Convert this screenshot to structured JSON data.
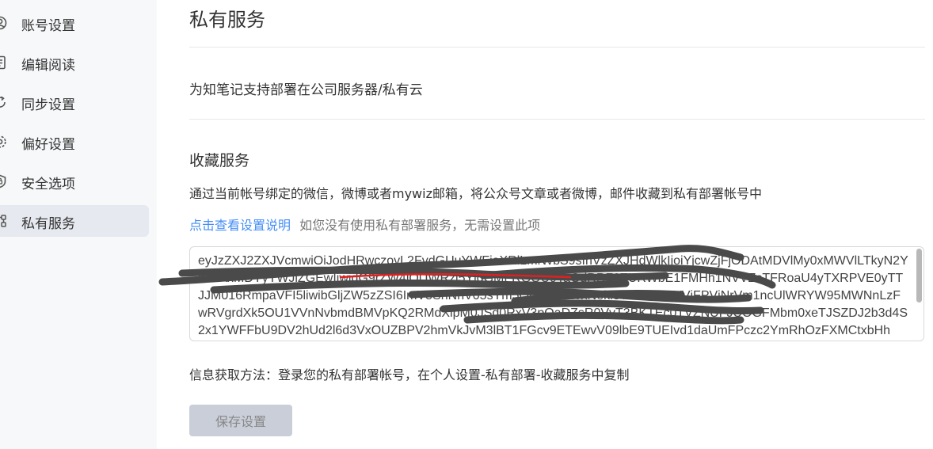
{
  "sidebar": {
    "items": [
      {
        "label": "账号设置",
        "icon": "user-circle-icon"
      },
      {
        "label": "编辑阅读",
        "icon": "document-icon"
      },
      {
        "label": "同步设置",
        "icon": "sync-icon"
      },
      {
        "label": "偏好设置",
        "icon": "gear-icon"
      },
      {
        "label": "安全选项",
        "icon": "shield-icon"
      },
      {
        "label": "私有服务",
        "icon": "network-icon",
        "active": true
      }
    ]
  },
  "main": {
    "title": "私有服务",
    "description": "为知笔记支持部署在公司服务器/私有云",
    "collect": {
      "title": "收藏服务",
      "description": "通过当前帐号绑定的微信，微博或者mywiz邮箱，将公众号文章或者微博，邮件收藏到私有部署帐号中",
      "help_link": "点击查看设置说明",
      "help_note": "如您没有使用私有部署服务，无需设置此项",
      "token_value": "eyJzZXJ2ZXJVcmwiOiJodHRwczovL2FvdGUuYWFiaXRlLmNvbS9sInVzZXJHdWlkIjoiYjcwZjFjODAtMDVlMy0xMWVlLTkyN2YtMTAxMDYyYWJiZGEwIiwidG9rZW4iOiJWRzl5YldGMFRGOU9TaGdRRF0TURWbE1FMHh1NVVZsTFRoaU4yTXRPVE0yTTJJM016RmpaVFI5liwibGljZW5zZSI6ImV5SnNhV05sYm5ObFNYTWxNekl3TmxOalNVVjFPVjNrVm1ncUlWRYW95MWNnLzFwRVgrdXk5OU1VVnNvbmdBMVpKQ2RMdXlpM0JSd0RxV3pQaDZsR0VvT3BKTEc0TVZNUFJUOGFMbm0xeTJSZDJ2b3d4S2x1YWFFbU9DV2hUd2l6d3VxOUZBPV2hmVkJvM3lBT1FGcv9ETEwvV09lbE9TUEIvd1daUmFPczc2YmRhOzFXMCtxbHh",
      "info_hint": "信息获取方法：登录您的私有部署帐号，在个人设置-私有部署-收藏服务中复制",
      "save_label": "保存设置"
    }
  }
}
